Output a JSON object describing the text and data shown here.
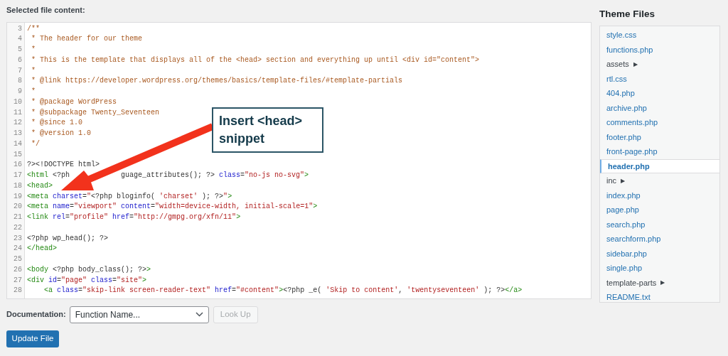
{
  "editor_label": "Selected file content:",
  "lines": [
    {
      "number": "3",
      "tokens": [
        {
          "kind": "comment",
          "text": "/**"
        }
      ]
    },
    {
      "number": "4",
      "tokens": [
        {
          "kind": "comment",
          "text": " * The header for our theme"
        }
      ]
    },
    {
      "number": "5",
      "tokens": [
        {
          "kind": "comment",
          "text": " *"
        }
      ]
    },
    {
      "number": "6",
      "tokens": [
        {
          "kind": "comment",
          "text": " * This is the template that displays all of the <head> section and everything up until <div id=\"content\">"
        }
      ]
    },
    {
      "number": "7",
      "tokens": [
        {
          "kind": "comment",
          "text": " *"
        }
      ]
    },
    {
      "number": "8",
      "tokens": [
        {
          "kind": "comment",
          "text": " * @link https://developer.wordpress.org/themes/basics/template-files/#template-partials"
        }
      ]
    },
    {
      "number": "9",
      "tokens": [
        {
          "kind": "comment",
          "text": " *"
        }
      ]
    },
    {
      "number": "10",
      "tokens": [
        {
          "kind": "comment",
          "text": " * @package WordPress"
        }
      ]
    },
    {
      "number": "11",
      "tokens": [
        {
          "kind": "comment",
          "text": " * @subpackage Twenty_Seventeen"
        }
      ]
    },
    {
      "number": "12",
      "tokens": [
        {
          "kind": "comment",
          "text": " * @since 1.0"
        }
      ]
    },
    {
      "number": "13",
      "tokens": [
        {
          "kind": "comment",
          "text": " * @version 1.0"
        }
      ]
    },
    {
      "number": "14",
      "tokens": [
        {
          "kind": "comment",
          "text": " */"
        }
      ]
    },
    {
      "number": "15"
    },
    {
      "number": "16",
      "tokens": [
        {
          "kind": "plain",
          "text": "?><!DOCTYPE html>"
        }
      ]
    },
    {
      "number": "17",
      "tokens": [
        {
          "kind": "tag",
          "text": "<html"
        },
        {
          "kind": "plain",
          "text": " <?ph"
        },
        {
          "kind": "covered"
        },
        {
          "kind": "plain",
          "text": "guage_attributes(); ?>"
        },
        {
          "kind": "attr",
          "text": " class"
        },
        {
          "kind": "plain",
          "text": "="
        },
        {
          "kind": "string",
          "text": "\"no-js no-svg\""
        },
        {
          "kind": "tag",
          "text": ">"
        }
      ]
    },
    {
      "number": "18",
      "tokens": [
        {
          "kind": "tag",
          "text": "<head>"
        }
      ]
    },
    {
      "number": "19",
      "tokens": [
        {
          "kind": "tag",
          "text": "<meta"
        },
        {
          "kind": "attr",
          "text": " charset"
        },
        {
          "kind": "plain",
          "text": "="
        },
        {
          "kind": "string",
          "text": "\""
        },
        {
          "kind": "plain",
          "text": "<?php bloginfo( "
        },
        {
          "kind": "string",
          "text": "'charset'"
        },
        {
          "kind": "plain",
          "text": " ); ?>"
        },
        {
          "kind": "string",
          "text": "\""
        },
        {
          "kind": "tag",
          "text": ">"
        }
      ]
    },
    {
      "number": "20",
      "tokens": [
        {
          "kind": "tag",
          "text": "<meta"
        },
        {
          "kind": "attr",
          "text": " name"
        },
        {
          "kind": "plain",
          "text": "="
        },
        {
          "kind": "string",
          "text": "\"viewport\""
        },
        {
          "kind": "attr",
          "text": " content"
        },
        {
          "kind": "plain",
          "text": "="
        },
        {
          "kind": "string",
          "text": "\"width=device-width, initial-scale=1\""
        },
        {
          "kind": "tag",
          "text": ">"
        }
      ]
    },
    {
      "number": "21",
      "tokens": [
        {
          "kind": "tag",
          "text": "<link"
        },
        {
          "kind": "attr",
          "text": " rel"
        },
        {
          "kind": "plain",
          "text": "="
        },
        {
          "kind": "string",
          "text": "\"profile\""
        },
        {
          "kind": "attr",
          "text": " href"
        },
        {
          "kind": "plain",
          "text": "="
        },
        {
          "kind": "string",
          "text": "\"http://gmpg.org/xfn/11\""
        },
        {
          "kind": "tag",
          "text": ">"
        }
      ]
    },
    {
      "number": "22"
    },
    {
      "number": "23",
      "tokens": [
        {
          "kind": "plain",
          "text": "<?php wp_head(); ?>"
        }
      ]
    },
    {
      "number": "24",
      "tokens": [
        {
          "kind": "tag",
          "text": "</head>"
        }
      ]
    },
    {
      "number": "25"
    },
    {
      "number": "26",
      "tokens": [
        {
          "kind": "tag",
          "text": "<body"
        },
        {
          "kind": "plain",
          "text": " <?php body_class(); ?>"
        },
        {
          "kind": "tag",
          "text": ">"
        }
      ]
    },
    {
      "number": "27",
      "tokens": [
        {
          "kind": "tag",
          "text": "<div"
        },
        {
          "kind": "attr",
          "text": " id"
        },
        {
          "kind": "plain",
          "text": "="
        },
        {
          "kind": "string",
          "text": "\"page\""
        },
        {
          "kind": "attr",
          "text": " class"
        },
        {
          "kind": "plain",
          "text": "="
        },
        {
          "kind": "string",
          "text": "\"site\""
        },
        {
          "kind": "tag",
          "text": ">"
        }
      ]
    },
    {
      "number": "28",
      "tokens": [
        {
          "kind": "tag",
          "text": "    <a"
        },
        {
          "kind": "attr",
          "text": " class"
        },
        {
          "kind": "plain",
          "text": "="
        },
        {
          "kind": "string",
          "text": "\"skip-link screen-reader-text\""
        },
        {
          "kind": "attr",
          "text": " href"
        },
        {
          "kind": "plain",
          "text": "="
        },
        {
          "kind": "string",
          "text": "\"#content\""
        },
        {
          "kind": "tag",
          "text": ">"
        },
        {
          "kind": "plain",
          "text": "<?php _e( "
        },
        {
          "kind": "string",
          "text": "'Skip to content'"
        },
        {
          "kind": "plain",
          "text": ", "
        },
        {
          "kind": "string",
          "text": "'twentyseventeen'"
        },
        {
          "kind": "plain",
          "text": " ); ?>"
        },
        {
          "kind": "tag",
          "text": "</a>"
        }
      ]
    }
  ],
  "callout": {
    "text": "Insert <head> snippet"
  },
  "documentation": {
    "label": "Documentation:",
    "select": "Function Name...",
    "button": "Look Up",
    "button_disabled": true
  },
  "update_button": "Update File",
  "sidebar": {
    "title": "Theme Files",
    "items": [
      {
        "kind": "file",
        "label": "style.css",
        "selected": false
      },
      {
        "kind": "file",
        "label": "functions.php",
        "selected": false
      },
      {
        "kind": "folder",
        "label": "assets",
        "arrow": "▶"
      },
      {
        "kind": "file",
        "label": "rtl.css",
        "selected": false
      },
      {
        "kind": "file",
        "label": "404.php",
        "selected": false
      },
      {
        "kind": "file",
        "label": "archive.php",
        "selected": false
      },
      {
        "kind": "file",
        "label": "comments.php",
        "selected": false
      },
      {
        "kind": "file",
        "label": "footer.php",
        "selected": false
      },
      {
        "kind": "file",
        "label": "front-page.php",
        "selected": false
      },
      {
        "kind": "file",
        "label": "header.php",
        "selected": true
      },
      {
        "kind": "folder",
        "label": "inc",
        "arrow": "▶"
      },
      {
        "kind": "file",
        "label": "index.php",
        "selected": false
      },
      {
        "kind": "file",
        "label": "page.php",
        "selected": false
      },
      {
        "kind": "file",
        "label": "search.php",
        "selected": false
      },
      {
        "kind": "file",
        "label": "searchform.php",
        "selected": false
      },
      {
        "kind": "file",
        "label": "sidebar.php",
        "selected": false
      },
      {
        "kind": "file",
        "label": "single.php",
        "selected": false
      },
      {
        "kind": "folder",
        "label": "template-parts",
        "arrow": "▶"
      },
      {
        "kind": "file",
        "label": "README.txt",
        "selected": false
      }
    ]
  }
}
